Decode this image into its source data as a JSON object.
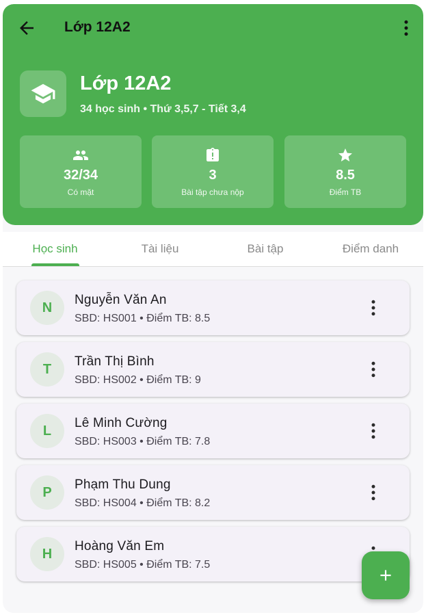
{
  "appbar": {
    "title": "Lớp 12A2"
  },
  "class_info": {
    "name": "Lớp 12A2",
    "subtitle": "34 học sinh • Thứ 3,5,7 - Tiết 3,4"
  },
  "stats": [
    {
      "icon": "people-icon",
      "value": "32/34",
      "label": "Có mặt"
    },
    {
      "icon": "clipboard-alert-icon",
      "value": "3",
      "label": "Bài tập chưa nộp"
    },
    {
      "icon": "star-icon",
      "value": "8.5",
      "label": "Điểm TB"
    }
  ],
  "tabs": [
    {
      "label": "Học sinh",
      "active": true
    },
    {
      "label": "Tài liệu",
      "active": false
    },
    {
      "label": "Bài tập",
      "active": false
    },
    {
      "label": "Điểm danh",
      "active": false
    }
  ],
  "students": [
    {
      "initial": "N",
      "name": "Nguyễn Văn An",
      "meta": "SBD: HS001 • Điểm TB: 8.5"
    },
    {
      "initial": "T",
      "name": "Trần Thị Bình",
      "meta": "SBD: HS002 • Điểm TB: 9"
    },
    {
      "initial": "L",
      "name": "Lê Minh Cường",
      "meta": "SBD: HS003 • Điểm TB: 7.8"
    },
    {
      "initial": "P",
      "name": "Phạm Thu Dung",
      "meta": "SBD: HS004 • Điểm TB: 8.2"
    },
    {
      "initial": "H",
      "name": "Hoàng Văn Em",
      "meta": "SBD: HS005 • Điểm TB: 7.5"
    }
  ],
  "colors": {
    "primary": "#4caf50",
    "card_bg": "#f4f1f8",
    "tab_inactive": "#8a8a8a"
  }
}
